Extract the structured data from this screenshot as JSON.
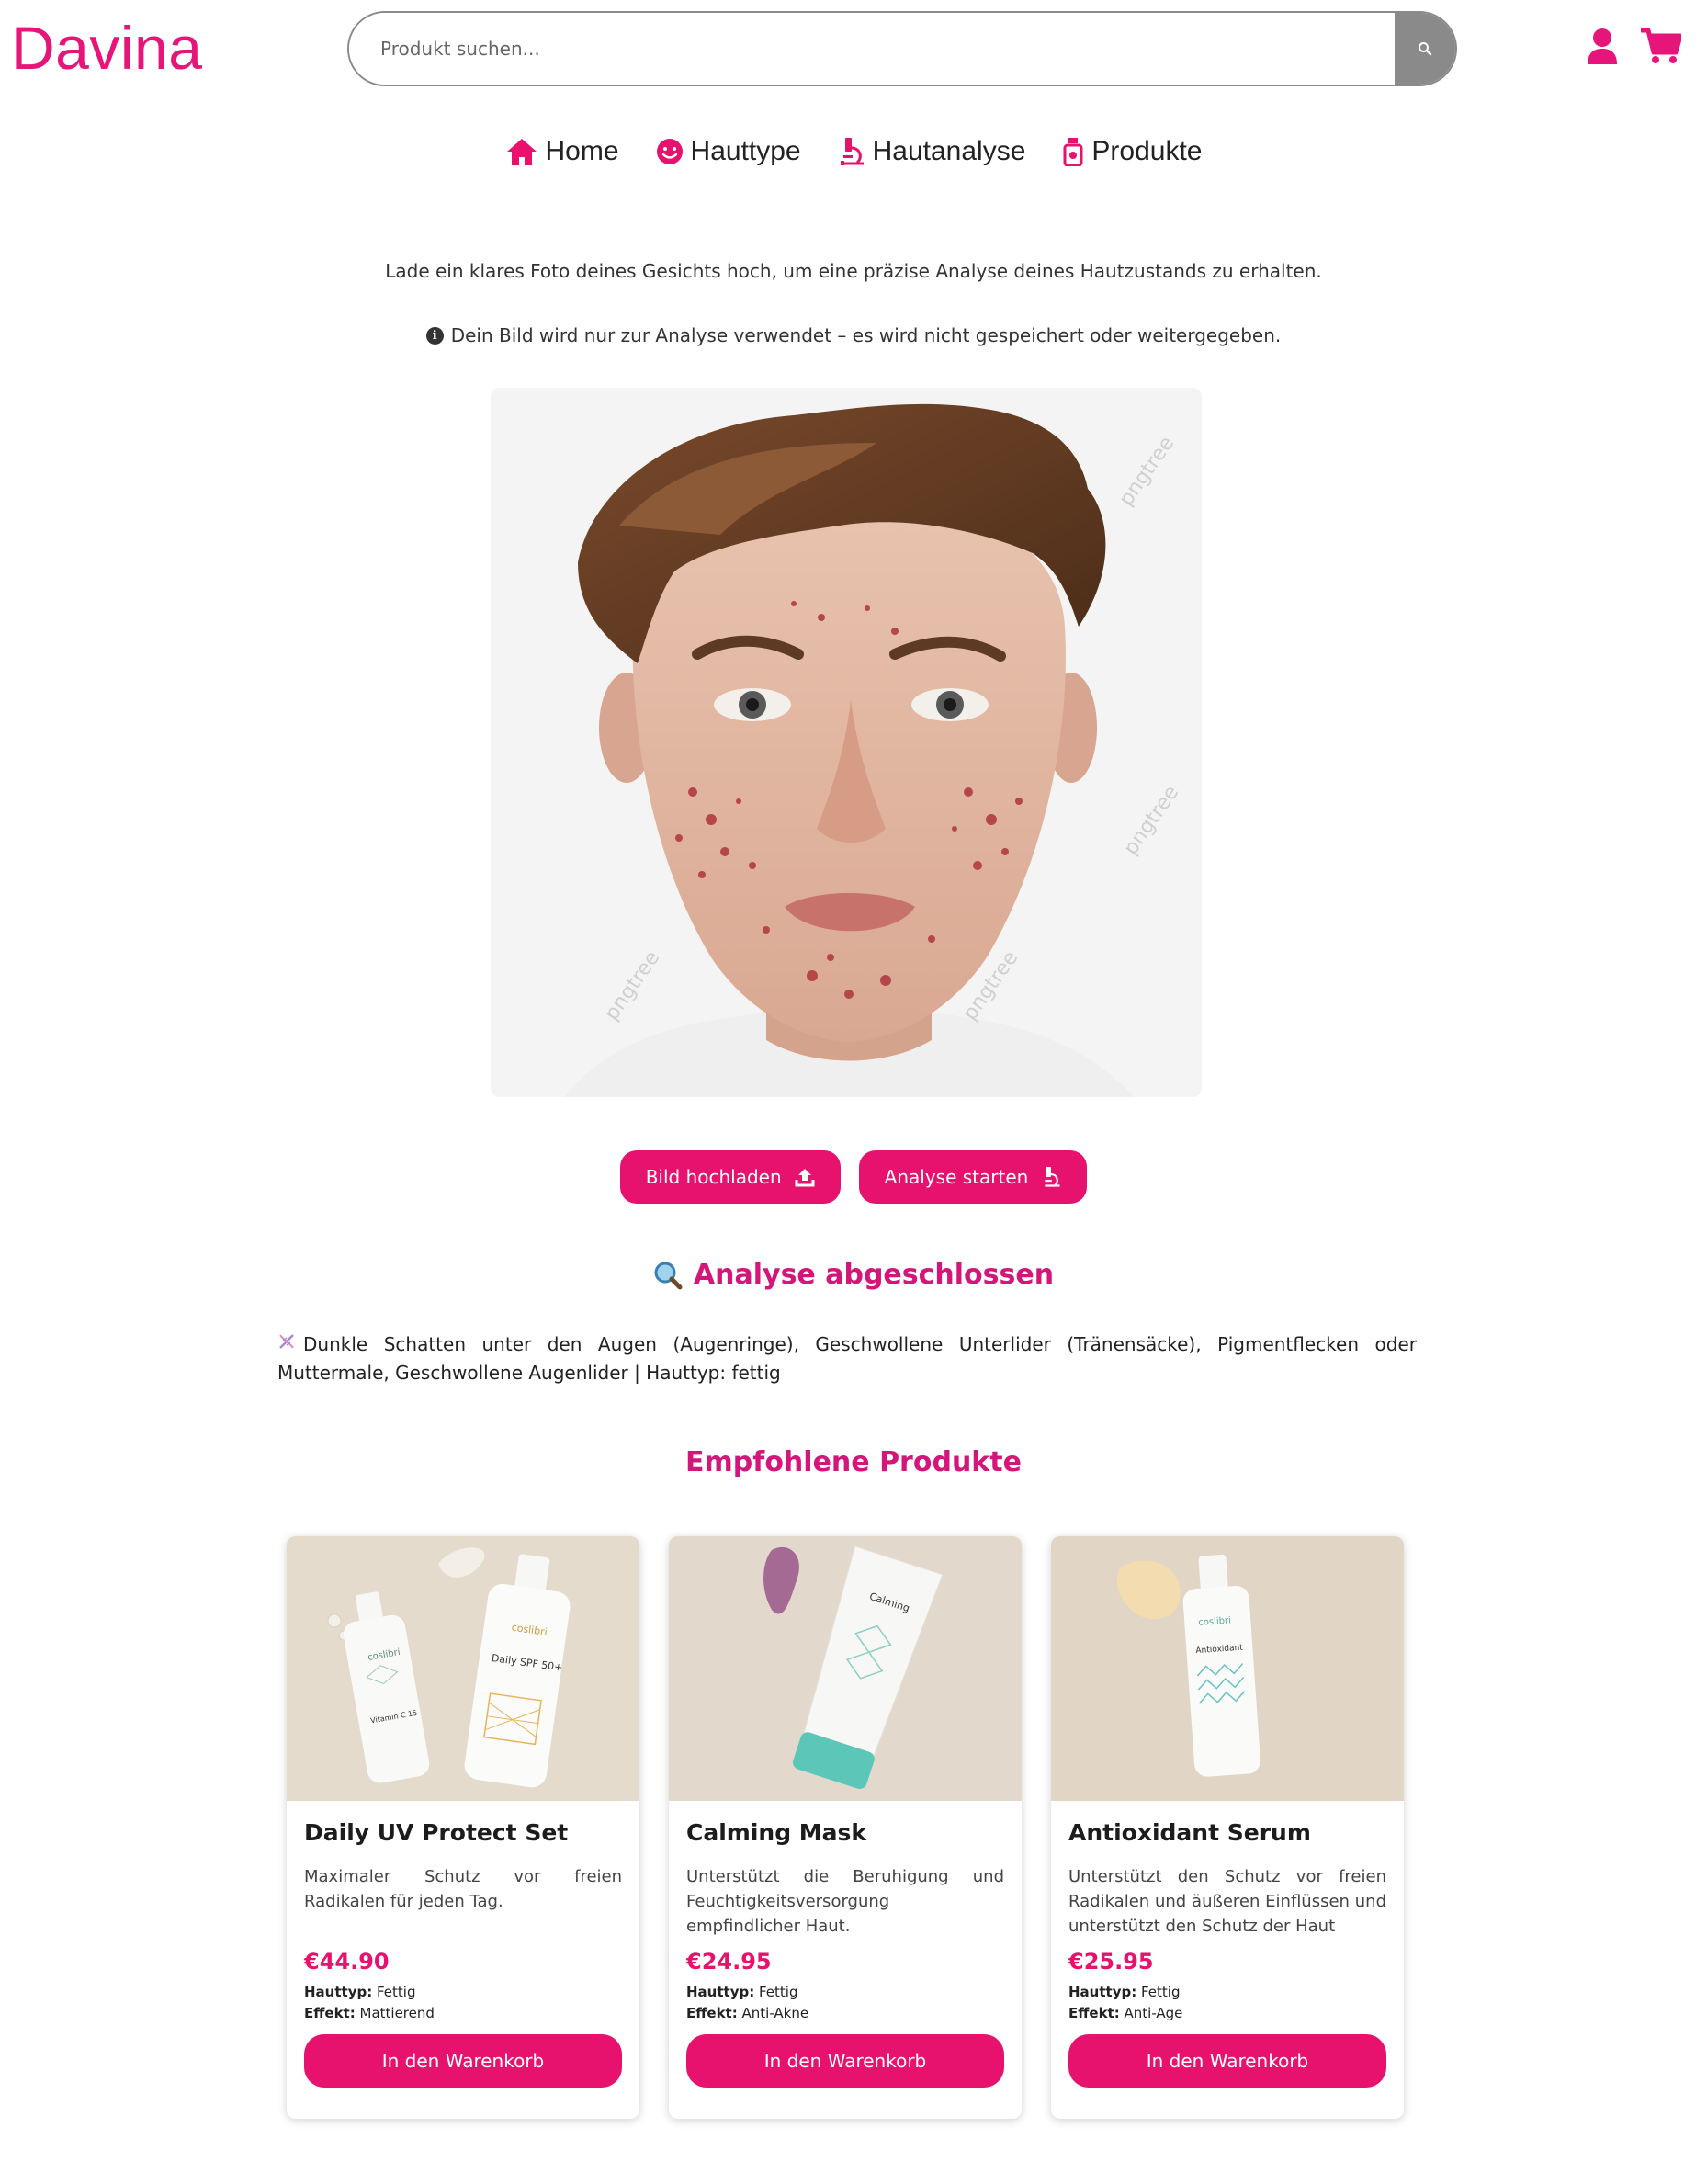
{
  "header": {
    "logo": "Davina",
    "search_placeholder": "Produkt suchen...",
    "brand_color": "#e6157a"
  },
  "nav": [
    {
      "label": "Home",
      "icon": "home-icon"
    },
    {
      "label": "Hauttype",
      "icon": "smiley-icon"
    },
    {
      "label": "Hautanalyse",
      "icon": "microscope-icon"
    },
    {
      "label": "Produkte",
      "icon": "bottle-icon"
    }
  ],
  "intro": "Lade ein klares Foto deines Gesichts hoch, um eine präzise Analyse deines Hautzustands zu erhalten.",
  "privacy_note": "Dein Bild wird nur zur Analyse verwendet – es wird nicht gespeichert oder weitergegeben.",
  "photo_watermark": "pngtree",
  "actions": {
    "upload_label": "Bild hochladen",
    "analyze_label": "Analyse starten"
  },
  "result": {
    "title": "Analyse abgeschlossen",
    "text": "Dunkle Schatten unter den Augen (Augenringe), Geschwollene Unterlider (Tränensäcke), Pigmentflecken oder Muttermale, Geschwollene Augenlider | Hauttyp: fettig"
  },
  "recommended_title": "Empfohlene Produkte",
  "products": [
    {
      "name": "Daily UV Protect Set",
      "description": "Maximaler Schutz vor freien Radikalen für jeden Tag.",
      "price": "€44.90",
      "skin_type_label": "Hauttyp:",
      "skin_type": "Fettig",
      "effect_label": "Effekt:",
      "effect": "Mattierend",
      "button": "In den Warenkorb",
      "bottle_brand": "coslibri",
      "bottle_a_text": "Vitamin C 15",
      "bottle_b_text": "Daily SPF 50+"
    },
    {
      "name": "Calming Mask",
      "description": "Unterstützt die Beruhigung und Feuchtigkeitsversorgung empfindlicher Haut.",
      "price": "€24.95",
      "skin_type_label": "Hauttyp:",
      "skin_type": "Fettig",
      "effect_label": "Effekt:",
      "effect": "Anti-Akne",
      "button": "In den Warenkorb",
      "bottle_text": "Calming"
    },
    {
      "name": "Antioxidant Serum",
      "description": "Unterstützt den Schutz vor freien Radikalen und äußeren Einflüssen und unterstützt den Schutz der Haut",
      "price": "€25.95",
      "skin_type_label": "Hauttyp:",
      "skin_type": "Fettig",
      "effect_label": "Effekt:",
      "effect": "Anti-Age",
      "button": "In den Warenkorb",
      "bottle_brand": "coslibri",
      "bottle_text": "Antioxidant"
    }
  ]
}
